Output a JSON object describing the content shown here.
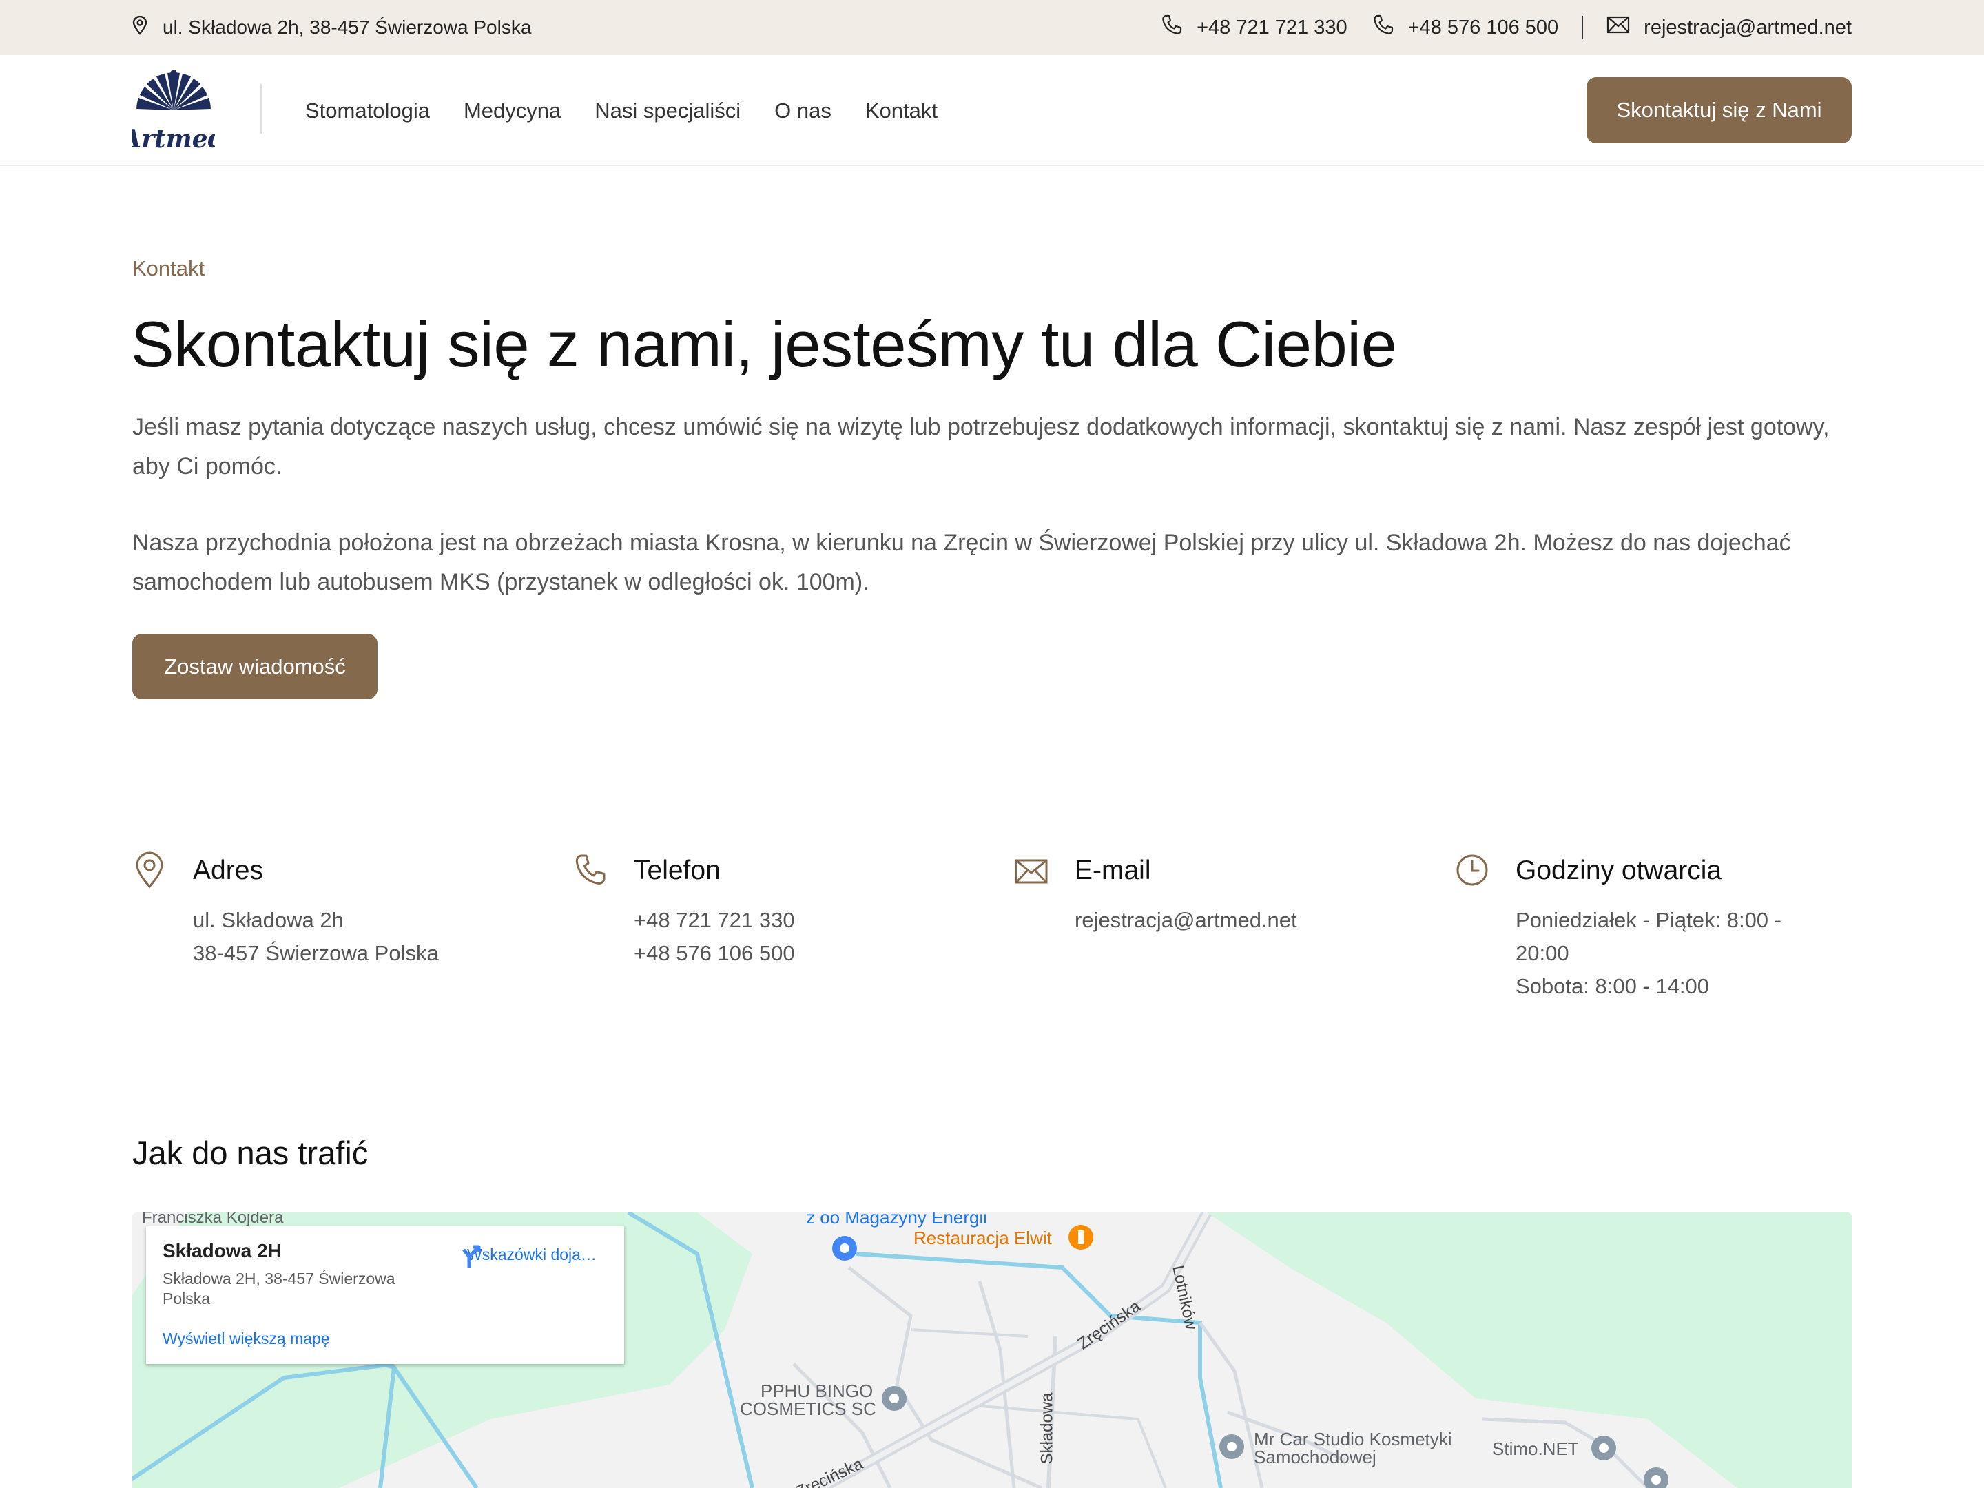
{
  "topbar": {
    "address": "ul. Składowa 2h, 38-457 Świerzowa Polska",
    "phone1": "+48 721 721 330",
    "phone2": "+48 576 106 500",
    "email": "rejestracja@artmed.net"
  },
  "header": {
    "logo_text": "Artmed",
    "nav": [
      "Stomatologia",
      "Medycyna",
      "Nasi specjaliści",
      "O nas",
      "Kontakt"
    ],
    "cta_label": "Skontaktuj się z Nami"
  },
  "intro": {
    "eyebrow": "Kontakt",
    "title": "Skontaktuj się z nami, jesteśmy tu dla Ciebie",
    "paragraph1": "Jeśli masz pytania dotyczące naszych usług, chcesz umówić się na wizytę lub potrzebujesz dodatkowych informacji, skontaktuj się z nami. Nasz zespół jest gotowy, aby Ci pomóc.",
    "paragraph2": "Nasza przychodnia położona jest na obrzeżach miasta Krosna, w kierunku na Zręcin w Świerzowej Polskiej przy ulicy ul. Składowa 2h. Możesz do nas dojechać samochodem lub autobusem MKS (przystanek w odległości ok. 100m).",
    "button_label": "Zostaw wiadomość"
  },
  "info": {
    "address": {
      "title": "Adres",
      "line1": "ul. Składowa 2h",
      "line2": "38-457 Świerzowa Polska",
      "icon": "location-pin-icon"
    },
    "phone": {
      "title": "Telefon",
      "line1": "+48 721 721 330",
      "line2": "+48 576 106 500",
      "icon": "phone-icon"
    },
    "email": {
      "title": "E-mail",
      "line1": "rejestracja@artmed.net",
      "icon": "envelope-icon"
    },
    "hours": {
      "title": "Godziny otwarcia",
      "line1": "Poniedziałek - Piątek: 8:00 - 20:00",
      "line2": "Sobota: 8:00 - 14:00",
      "icon": "clock-icon"
    }
  },
  "directions": {
    "title": "Jak do nas trafić"
  },
  "map": {
    "infobox_title": "Składowa 2H",
    "infobox_address": "Składowa 2H, 38-457 Świerzowa Polska",
    "directions_label": "Wskazówki doja…",
    "larger_map_link": "Wyświetl większą mapę",
    "labels": {
      "street_top": "Franciszka Kojdera",
      "company_top": "z oo Magazyny Energii",
      "restaurant": "Restauracja Elwit",
      "road_zrecinska": "Zręcińska",
      "road_zrecinska2": "Zręcińska",
      "road_lotnikow": "Lotników",
      "road_skladowa": "Składowa",
      "poi_bingo_1": "PPHU BINGO",
      "poi_bingo_2": "COSMETICS SC",
      "poi_mrcar_1": "Mr Car Studio Kosmetyki",
      "poi_mrcar_2": "Samochodowej",
      "poi_stimo": "Stimo.NET"
    },
    "colors": {
      "green": "#d4f5e0",
      "river": "#8dd0e8",
      "road": "#ffffff",
      "road_major": "#d6dbe1"
    }
  },
  "colors": {
    "accent": "#84694c",
    "topbar_bg": "#f1ede6",
    "logo_navy": "#1f2d5c"
  }
}
